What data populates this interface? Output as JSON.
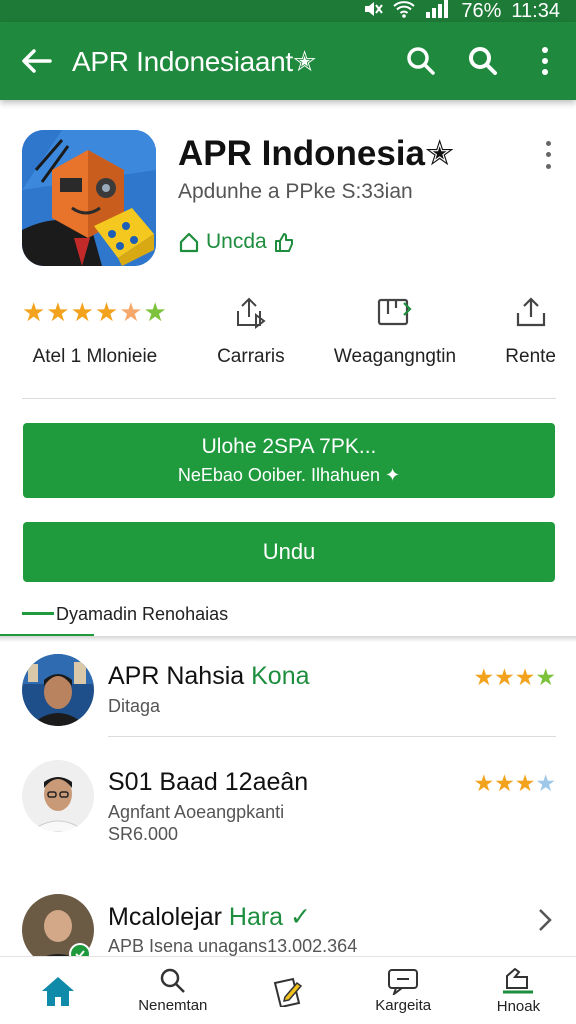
{
  "status_bar": {
    "battery": "76%",
    "time": "11:34"
  },
  "app_bar": {
    "title": "APR Indonesiaant✭",
    "back_icon": "arrow-left-icon",
    "actions": [
      "search-icon",
      "search-icon",
      "more-vert-icon"
    ]
  },
  "app": {
    "name": "APR Indonesia✭",
    "subtitle": "Apdunhe a PPke S:33ian",
    "install_label": "Uncda",
    "stats": [
      {
        "kind": "rating",
        "stars": 4.5,
        "label": "Atel 1 Mlonieie"
      },
      {
        "kind": "icon",
        "icon": "share-arrow-icon",
        "label": "Carraris"
      },
      {
        "kind": "icon",
        "icon": "clipboard-icon",
        "label": "Weagangngtin"
      },
      {
        "kind": "icon",
        "icon": "upload-icon",
        "label": "Rente"
      }
    ]
  },
  "promo": {
    "line1": "Ulohe 2SPA 7PK...",
    "line2": "NeEbao Ooiber. Ilhahuen ✦"
  },
  "install_button": {
    "label": "Undu"
  },
  "tab": {
    "label": "Dyamadin Renohaias"
  },
  "reviews": [
    {
      "name": "APR Nahsia",
      "name_accent": "Kona",
      "meta": [
        "Ditaga"
      ],
      "stars": 4
    },
    {
      "name": "S01 Baad 12aeân",
      "name_accent": "",
      "meta": [
        "Agnfant Aoeangpkanti",
        "SR6.000"
      ],
      "stars": 3.5
    },
    {
      "name": "Mcalolejar",
      "name_accent": "Hara ✓",
      "meta": [
        "APB Isena unagans13.002.364"
      ],
      "stars": null
    }
  ],
  "bottom_nav": [
    {
      "icon": "home-icon",
      "label": ""
    },
    {
      "icon": "search-icon",
      "label": "Nenemtan"
    },
    {
      "icon": "edit-document-icon",
      "label": ""
    },
    {
      "icon": "message-icon",
      "label": "Kargeita"
    },
    {
      "icon": "share-hand-icon",
      "label": "Hnoak"
    }
  ],
  "colors": {
    "brand_green": "#1f8a3e",
    "button_green": "#1f9a3d",
    "accent_green": "#1e8e3e",
    "star": "#f2a21c"
  }
}
